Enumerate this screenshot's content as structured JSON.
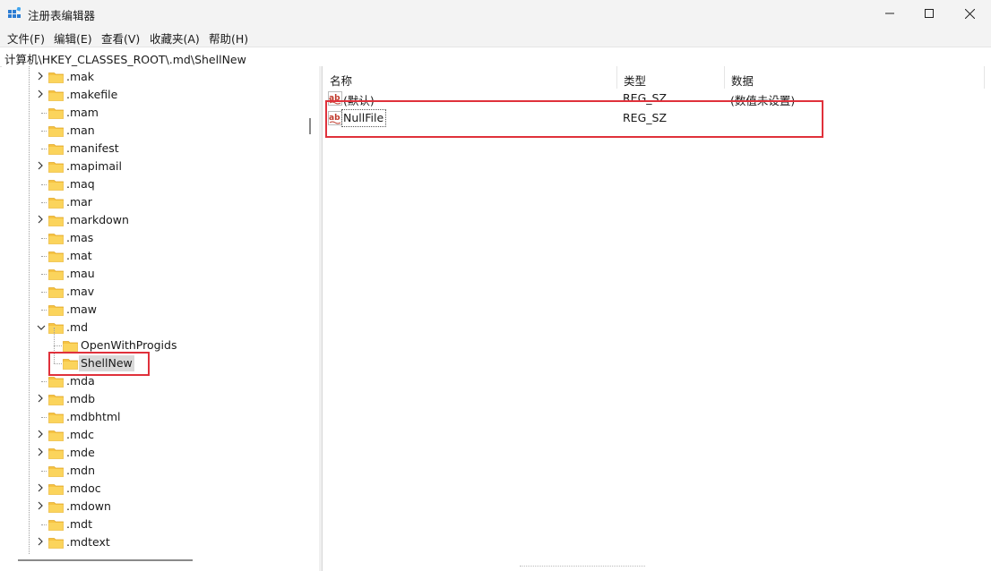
{
  "window": {
    "title": "注册表编辑器",
    "icon": "registry-editor-icon",
    "controls": [
      "minimize",
      "maximize",
      "close"
    ]
  },
  "menu": [
    "文件(F)",
    "编辑(E)",
    "查看(V)",
    "收藏夹(A)",
    "帮助(H)"
  ],
  "address": "计算机\\HKEY_CLASSES_ROOT\\.md\\ShellNew",
  "tree": [
    {
      "label": ".mak",
      "expandable": true
    },
    {
      "label": ".makefile",
      "expandable": true
    },
    {
      "label": ".mam",
      "expandable": false
    },
    {
      "label": ".man",
      "expandable": false
    },
    {
      "label": ".manifest",
      "expandable": false
    },
    {
      "label": ".mapimail",
      "expandable": true
    },
    {
      "label": ".maq",
      "expandable": false
    },
    {
      "label": ".mar",
      "expandable": false
    },
    {
      "label": ".markdown",
      "expandable": true
    },
    {
      "label": ".mas",
      "expandable": false
    },
    {
      "label": ".mat",
      "expandable": false
    },
    {
      "label": ".mau",
      "expandable": false
    },
    {
      "label": ".mav",
      "expandable": false
    },
    {
      "label": ".maw",
      "expandable": false
    },
    {
      "label": ".md",
      "expandable": true,
      "expanded": true
    },
    {
      "label": "OpenWithProgids",
      "child": true
    },
    {
      "label": "ShellNew",
      "child": true,
      "selected": true
    },
    {
      "label": ".mda",
      "expandable": false
    },
    {
      "label": ".mdb",
      "expandable": true
    },
    {
      "label": ".mdbhtml",
      "expandable": false
    },
    {
      "label": ".mdc",
      "expandable": true
    },
    {
      "label": ".mde",
      "expandable": true
    },
    {
      "label": ".mdn",
      "expandable": false
    },
    {
      "label": ".mdoc",
      "expandable": true
    },
    {
      "label": ".mdown",
      "expandable": true
    },
    {
      "label": ".mdt",
      "expandable": false
    },
    {
      "label": ".mdtext",
      "expandable": true
    }
  ],
  "columns": [
    "名称",
    "类型",
    "数据"
  ],
  "values": [
    {
      "name": "(默认)",
      "type": "REG_SZ",
      "data": "(数值未设置)"
    },
    {
      "name": "NullFile",
      "type": "REG_SZ",
      "data": ""
    }
  ],
  "colors": {
    "highlight": "#e0313b",
    "folder": "#f6c342",
    "selection": "#d9d9d9"
  }
}
